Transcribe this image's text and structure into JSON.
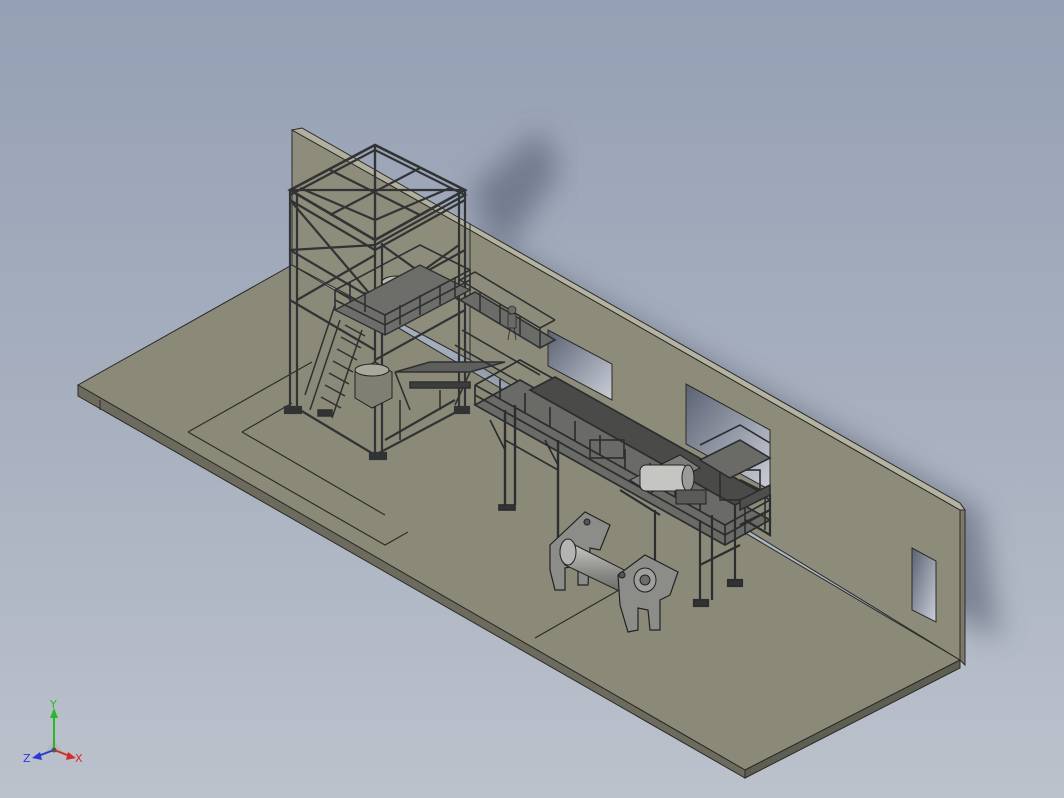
{
  "viewport": {
    "background_top": "#95a0b4",
    "background_bottom": "#bcc2cc"
  },
  "model": {
    "floor_color": "#8b8a79",
    "wall_color": "#8d8c7a",
    "steel_color": "#3a3b3c",
    "drum_color": "#9a9b98"
  },
  "triad": {
    "y_label": "Y",
    "x_label": "X",
    "z_label": "Z",
    "x_color": "#d42a2a",
    "y_color": "#2ab82a",
    "z_color": "#2a3ad4"
  }
}
